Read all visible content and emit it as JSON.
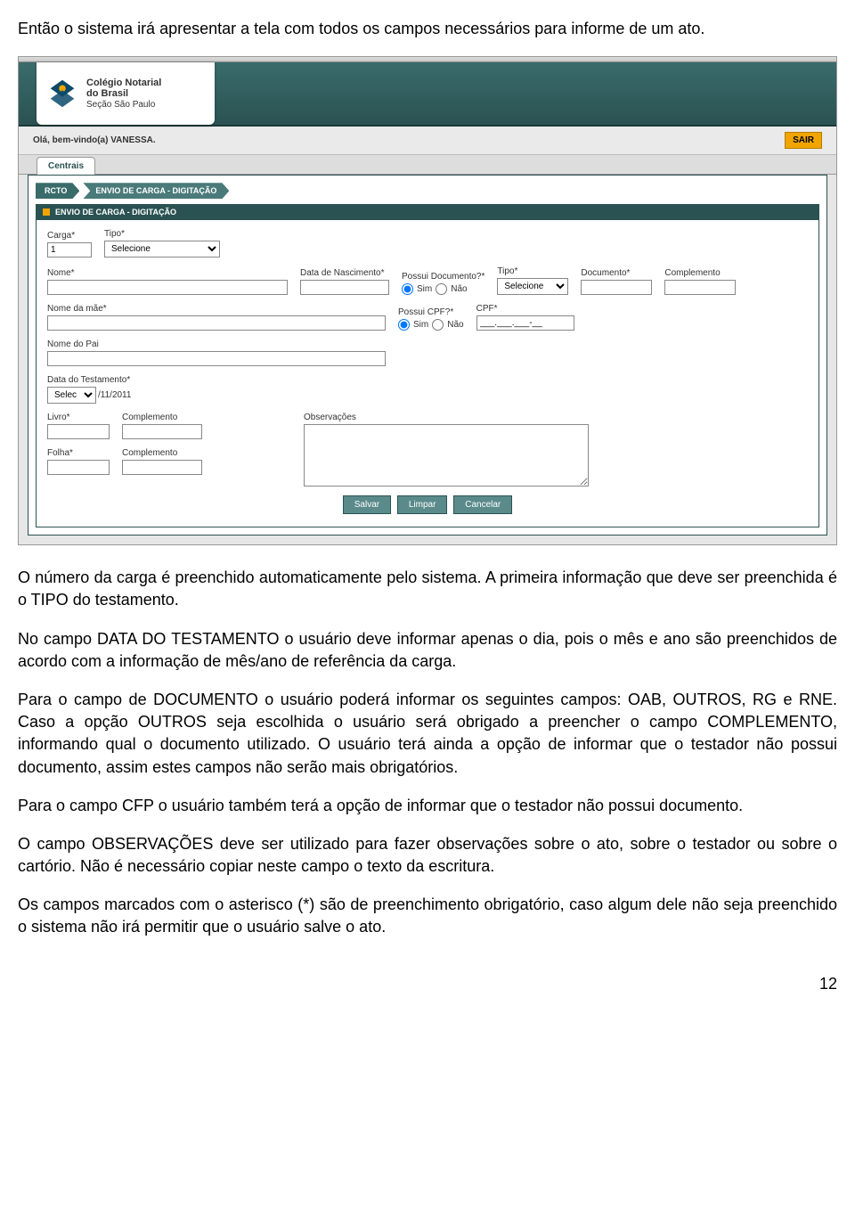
{
  "intro": "Então o sistema irá apresentar a tela com todos os campos necessários para informe de um ato.",
  "app": {
    "logo": {
      "line1": "Colégio Notarial",
      "line2": "do Brasil",
      "line3": "Seção São Paulo"
    },
    "welcome": "Olá, bem-vindo(a) VANESSA.",
    "sair": "SAIR",
    "tab": "Centrais",
    "breadcrumb": {
      "a": "RCTO",
      "b": "ENVIO DE CARGA - DIGITAÇÃO"
    },
    "panel_title": "ENVIO DE CARGA - DIGITAÇÃO",
    "labels": {
      "carga": "Carga*",
      "tipo": "Tipo*",
      "nome": "Nome*",
      "data_nasc": "Data de Nascimento*",
      "possui_doc": "Possui Documento?*",
      "doc_tipo": "Tipo*",
      "documento": "Documento*",
      "complemento": "Complemento",
      "nome_mae": "Nome da mãe*",
      "possui_cpf": "Possui CPF?*",
      "cpf": "CPF*",
      "nome_pai": "Nome do Pai",
      "data_test": "Data do Testamento*",
      "livro": "Livro*",
      "folha": "Folha*",
      "obs": "Observações"
    },
    "values": {
      "carga": "1",
      "tipo_sel": "Selecione",
      "doc_tipo_sel": "Selecione",
      "sim": "Sim",
      "nao": "Não",
      "data_test_sel": "Selec",
      "data_test_fixed": "/11/2011",
      "cpf_mask": "___.___.___-__"
    },
    "buttons": {
      "salvar": "Salvar",
      "limpar": "Limpar",
      "cancelar": "Cancelar"
    }
  },
  "paragraphs": {
    "p1": "O número da carga é preenchido automaticamente pelo sistema. A primeira informação que deve ser preenchida é o TIPO do testamento.",
    "p2": "No campo DATA DO TESTAMENTO o usuário deve informar apenas o dia, pois o mês e ano são preenchidos de acordo com a informação de mês/ano de referência da carga.",
    "p3": "Para o campo de DOCUMENTO o usuário poderá informar os seguintes campos: OAB, OUTROS, RG e RNE. Caso a opção OUTROS seja escolhida o usuário será obrigado a preencher o campo COMPLEMENTO, informando qual o documento utilizado. O usuário terá ainda a opção de informar que o testador não possui documento, assim estes campos não serão mais obrigatórios.",
    "p4": "Para o campo CFP o usuário também terá a opção de informar que o testador não possui documento.",
    "p5": "O campo OBSERVAÇÕES deve ser utilizado para fazer observações sobre o ato, sobre o testador ou sobre o cartório. Não é necessário copiar neste campo o texto da escritura.",
    "p6": "Os campos marcados com o asterisco (*) são de preenchimento obrigatório, caso algum dele não seja preenchido o sistema não irá permitir que o usuário salve o ato."
  },
  "page_number": "12"
}
